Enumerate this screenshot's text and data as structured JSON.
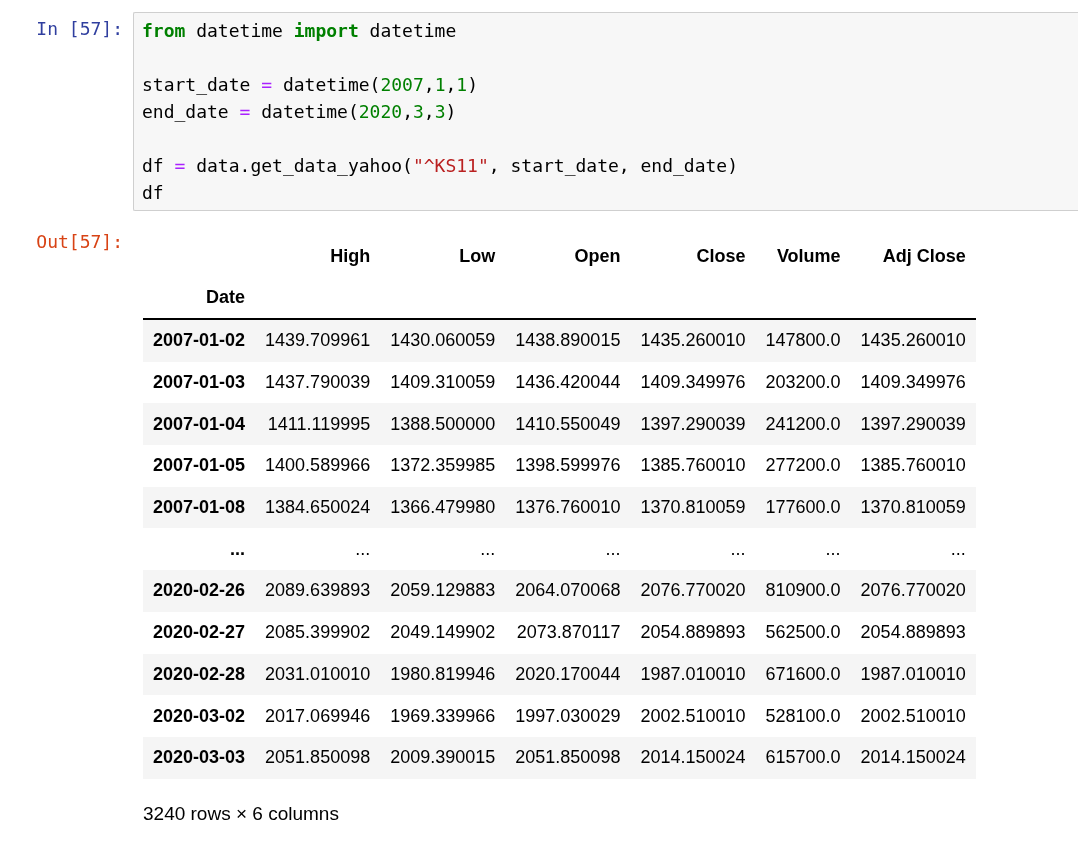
{
  "input_cell": {
    "prompt": "In [57]:",
    "lines": [
      {
        "kind": "code",
        "tokens": [
          {
            "kind": "keyword",
            "text": "from"
          },
          {
            "kind": "plain",
            "text": " datetime "
          },
          {
            "kind": "keyword",
            "text": "import"
          },
          {
            "kind": "plain",
            "text": " datetime"
          }
        ]
      },
      {
        "kind": "blank"
      },
      {
        "kind": "code",
        "tokens": [
          {
            "kind": "plain",
            "text": "start_date "
          },
          {
            "kind": "operator",
            "text": "="
          },
          {
            "kind": "plain",
            "text": " datetime("
          },
          {
            "kind": "number",
            "text": "2007"
          },
          {
            "kind": "plain",
            "text": ","
          },
          {
            "kind": "number",
            "text": "1"
          },
          {
            "kind": "plain",
            "text": ","
          },
          {
            "kind": "number",
            "text": "1"
          },
          {
            "kind": "plain",
            "text": ")"
          }
        ]
      },
      {
        "kind": "code",
        "tokens": [
          {
            "kind": "plain",
            "text": "end_date "
          },
          {
            "kind": "operator",
            "text": "="
          },
          {
            "kind": "plain",
            "text": " datetime("
          },
          {
            "kind": "number",
            "text": "2020"
          },
          {
            "kind": "plain",
            "text": ","
          },
          {
            "kind": "number",
            "text": "3"
          },
          {
            "kind": "plain",
            "text": ","
          },
          {
            "kind": "number",
            "text": "3"
          },
          {
            "kind": "plain",
            "text": ")"
          }
        ]
      },
      {
        "kind": "blank"
      },
      {
        "kind": "code",
        "tokens": [
          {
            "kind": "plain",
            "text": "df "
          },
          {
            "kind": "operator",
            "text": "="
          },
          {
            "kind": "plain",
            "text": " data.get_data_yahoo("
          },
          {
            "kind": "string",
            "text": "\"^KS11\""
          },
          {
            "kind": "plain",
            "text": ", start_date, end_date)"
          }
        ]
      },
      {
        "kind": "code",
        "tokens": [
          {
            "kind": "plain",
            "text": "df"
          }
        ]
      }
    ]
  },
  "output_cell": {
    "prompt": "Out[57]:",
    "table": {
      "columns": [
        "High",
        "Low",
        "Open",
        "Close",
        "Volume",
        "Adj Close"
      ],
      "index_name": "Date",
      "rows": [
        {
          "index": "2007-01-02",
          "cells": [
            "1439.709961",
            "1430.060059",
            "1438.890015",
            "1435.260010",
            "147800.0",
            "1435.260010"
          ]
        },
        {
          "index": "2007-01-03",
          "cells": [
            "1437.790039",
            "1409.310059",
            "1436.420044",
            "1409.349976",
            "203200.0",
            "1409.349976"
          ]
        },
        {
          "index": "2007-01-04",
          "cells": [
            "1411.119995",
            "1388.500000",
            "1410.550049",
            "1397.290039",
            "241200.0",
            "1397.290039"
          ]
        },
        {
          "index": "2007-01-05",
          "cells": [
            "1400.589966",
            "1372.359985",
            "1398.599976",
            "1385.760010",
            "277200.0",
            "1385.760010"
          ]
        },
        {
          "index": "2007-01-08",
          "cells": [
            "1384.650024",
            "1366.479980",
            "1376.760010",
            "1370.810059",
            "177600.0",
            "1370.810059"
          ]
        },
        {
          "index": "...",
          "cells": [
            "...",
            "...",
            "...",
            "...",
            "...",
            "..."
          ]
        },
        {
          "index": "2020-02-26",
          "cells": [
            "2089.639893",
            "2059.129883",
            "2064.070068",
            "2076.770020",
            "810900.0",
            "2076.770020"
          ]
        },
        {
          "index": "2020-02-27",
          "cells": [
            "2085.399902",
            "2049.149902",
            "2073.870117",
            "2054.889893",
            "562500.0",
            "2054.889893"
          ]
        },
        {
          "index": "2020-02-28",
          "cells": [
            "2031.010010",
            "1980.819946",
            "2020.170044",
            "1987.010010",
            "671600.0",
            "1987.010010"
          ]
        },
        {
          "index": "2020-03-02",
          "cells": [
            "2017.069946",
            "1969.339966",
            "1997.030029",
            "2002.510010",
            "528100.0",
            "2002.510010"
          ]
        },
        {
          "index": "2020-03-03",
          "cells": [
            "2051.850098",
            "2009.390015",
            "2051.850098",
            "2014.150024",
            "615700.0",
            "2014.150024"
          ]
        }
      ]
    },
    "summary": "3240 rows × 6 columns"
  }
}
